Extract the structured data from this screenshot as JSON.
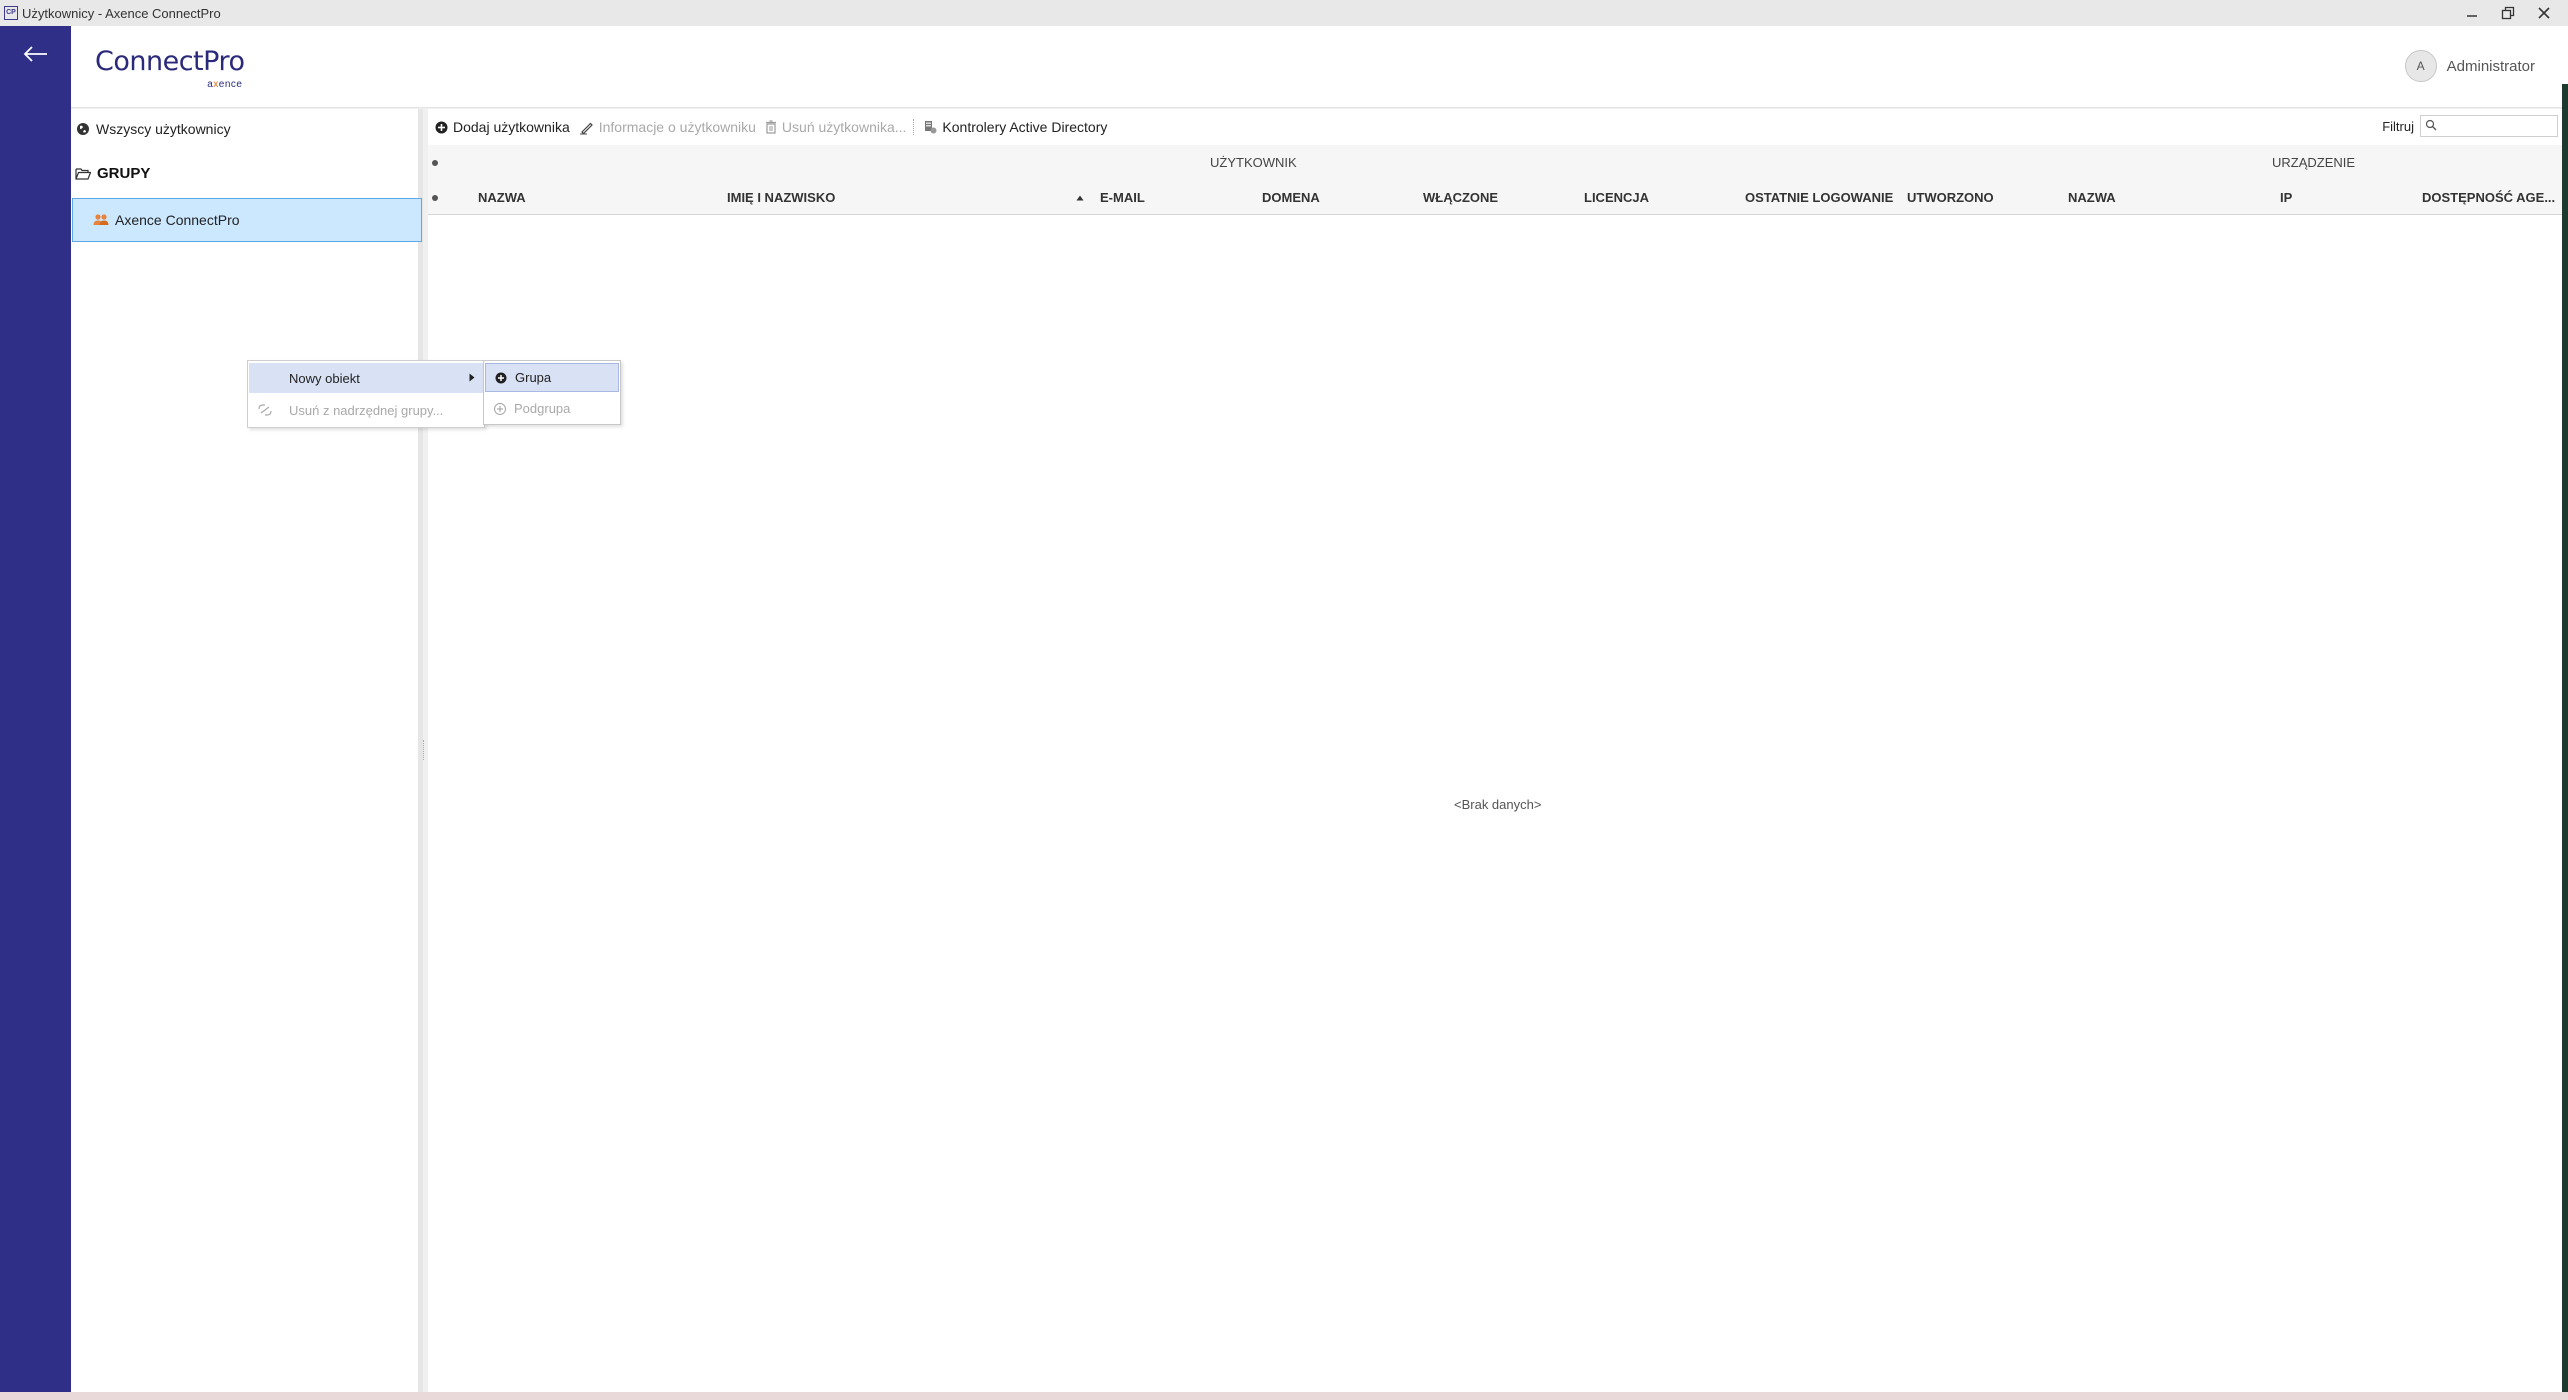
{
  "window": {
    "title": "Użytkownicy - Axence ConnectPro",
    "icon_text": "CP"
  },
  "header": {
    "logo_brand": "ConnectPro",
    "logo_sub_prefix": "a",
    "logo_sub_accent": "x",
    "logo_sub_suffix": "ence",
    "avatar_initial": "A",
    "user_name": "Administrator"
  },
  "sidebar": {
    "all_users_label": "Wszyscy użytkownicy",
    "groups_title": "GRUPY",
    "groups": [
      {
        "label": "Axence ConnectPro",
        "selected": true
      }
    ]
  },
  "toolbar": {
    "add_user": "Dodaj użytkownika",
    "user_info": "Informacje o użytkowniku",
    "delete_user": "Usuń użytkownika...",
    "ad_controllers": "Kontrolery Active Directory",
    "filter_label": "Filtruj",
    "filter_value": ""
  },
  "table": {
    "group_headers": [
      "UŻYTKOWNIK",
      "URZĄDZENIE"
    ],
    "columns": [
      "NAZWA",
      "IMIĘ I NAZWISKO",
      "E-MAIL",
      "DOMENA",
      "WŁĄCZONE",
      "LICENCJA",
      "OSTATNIE LOGOWANIE",
      "UTWORZONO",
      "NAZWA",
      "IP",
      "DOSTĘPNOŚĆ AGE..."
    ],
    "sort_column": "IMIĘ I NAZWISKO",
    "sort_direction": "ascending",
    "rows": [],
    "empty_message": "<Brak danych>"
  },
  "context_menu": {
    "items": [
      {
        "label": "Nowy obiekt",
        "enabled": true,
        "highlighted": true,
        "has_submenu": true
      },
      {
        "label": "Usuń z nadrzędnej grupy...",
        "enabled": false
      }
    ],
    "submenu": [
      {
        "label": "Grupa",
        "enabled": true,
        "highlighted": true
      },
      {
        "label": "Podgrupa",
        "enabled": false
      }
    ]
  },
  "colors": {
    "rail": "#2f2f87",
    "brand": "#2b2a7a",
    "accent": "#e86b1a",
    "selection": "#cce8ff",
    "menu_highlight": "#d9e1f4"
  }
}
